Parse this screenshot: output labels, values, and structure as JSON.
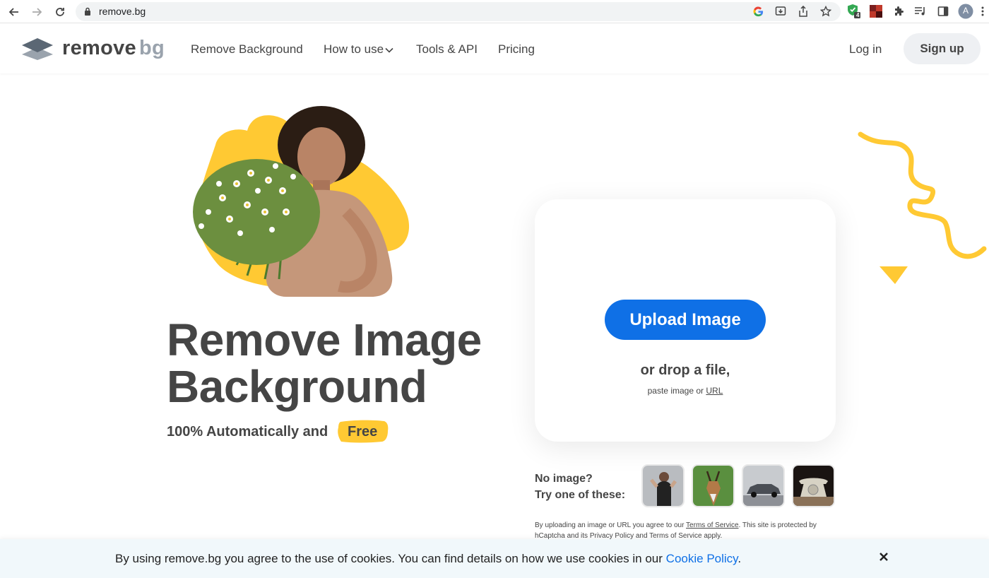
{
  "browser": {
    "url": "remove.bg",
    "extension_badge": "4",
    "profile_initial": "A"
  },
  "header": {
    "logo_main": "remove",
    "logo_accent": "bg",
    "nav": [
      "Remove Background",
      "How to use",
      "Tools & API",
      "Pricing"
    ],
    "login": "Log in",
    "signup": "Sign up"
  },
  "hero": {
    "title_line1": "Remove Image",
    "title_line2": "Background",
    "subtitle": "100% Automatically and",
    "free_badge": "Free"
  },
  "upload_card": {
    "button": "Upload Image",
    "drop_text": "or drop a file,",
    "paste_text": "paste image or",
    "url_link": "URL"
  },
  "samples": {
    "line1": "No image?",
    "line2": "Try one of these:",
    "thumbnails": [
      "woman-sample",
      "antelope-sample",
      "car-sample",
      "telephone-sample"
    ]
  },
  "terms": {
    "prefix": "By uploading an image or URL you agree to our",
    "tos_link": "Terms of Service",
    "suffix": ". This site is protected by hCaptcha and its Privacy Policy and Terms of Service apply."
  },
  "cookie": {
    "text": "By using remove.bg you agree to the use of cookies. You can find details on how we use cookies in our",
    "link": "Cookie Policy",
    "end": "."
  },
  "colors": {
    "accent_blue": "#0f70e6",
    "brand_yellow": "#ffc933",
    "text_dark": "#454545"
  }
}
